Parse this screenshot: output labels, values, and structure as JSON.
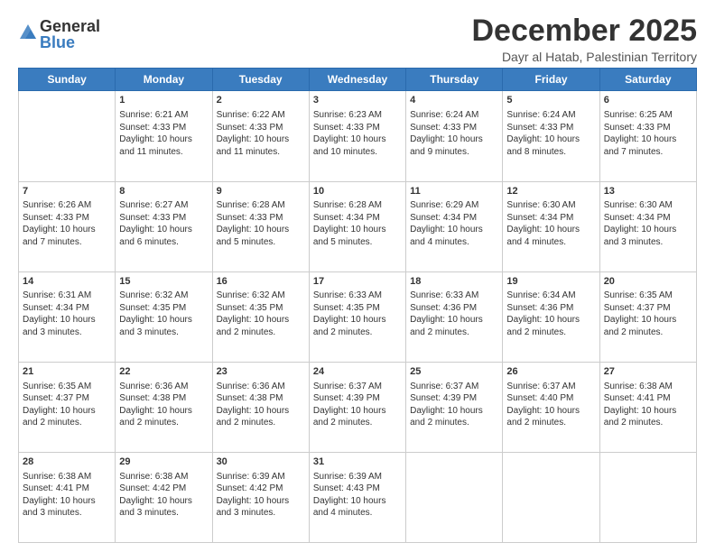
{
  "logo": {
    "general": "General",
    "blue": "Blue"
  },
  "title": "December 2025",
  "location": "Dayr al Hatab, Palestinian Territory",
  "days_of_week": [
    "Sunday",
    "Monday",
    "Tuesday",
    "Wednesday",
    "Thursday",
    "Friday",
    "Saturday"
  ],
  "weeks": [
    [
      {
        "day": "",
        "sunrise": "",
        "sunset": "",
        "daylight": ""
      },
      {
        "day": "1",
        "sunrise": "Sunrise: 6:21 AM",
        "sunset": "Sunset: 4:33 PM",
        "daylight": "Daylight: 10 hours and 11 minutes."
      },
      {
        "day": "2",
        "sunrise": "Sunrise: 6:22 AM",
        "sunset": "Sunset: 4:33 PM",
        "daylight": "Daylight: 10 hours and 11 minutes."
      },
      {
        "day": "3",
        "sunrise": "Sunrise: 6:23 AM",
        "sunset": "Sunset: 4:33 PM",
        "daylight": "Daylight: 10 hours and 10 minutes."
      },
      {
        "day": "4",
        "sunrise": "Sunrise: 6:24 AM",
        "sunset": "Sunset: 4:33 PM",
        "daylight": "Daylight: 10 hours and 9 minutes."
      },
      {
        "day": "5",
        "sunrise": "Sunrise: 6:24 AM",
        "sunset": "Sunset: 4:33 PM",
        "daylight": "Daylight: 10 hours and 8 minutes."
      },
      {
        "day": "6",
        "sunrise": "Sunrise: 6:25 AM",
        "sunset": "Sunset: 4:33 PM",
        "daylight": "Daylight: 10 hours and 7 minutes."
      }
    ],
    [
      {
        "day": "7",
        "sunrise": "Sunrise: 6:26 AM",
        "sunset": "Sunset: 4:33 PM",
        "daylight": "Daylight: 10 hours and 7 minutes."
      },
      {
        "day": "8",
        "sunrise": "Sunrise: 6:27 AM",
        "sunset": "Sunset: 4:33 PM",
        "daylight": "Daylight: 10 hours and 6 minutes."
      },
      {
        "day": "9",
        "sunrise": "Sunrise: 6:28 AM",
        "sunset": "Sunset: 4:33 PM",
        "daylight": "Daylight: 10 hours and 5 minutes."
      },
      {
        "day": "10",
        "sunrise": "Sunrise: 6:28 AM",
        "sunset": "Sunset: 4:34 PM",
        "daylight": "Daylight: 10 hours and 5 minutes."
      },
      {
        "day": "11",
        "sunrise": "Sunrise: 6:29 AM",
        "sunset": "Sunset: 4:34 PM",
        "daylight": "Daylight: 10 hours and 4 minutes."
      },
      {
        "day": "12",
        "sunrise": "Sunrise: 6:30 AM",
        "sunset": "Sunset: 4:34 PM",
        "daylight": "Daylight: 10 hours and 4 minutes."
      },
      {
        "day": "13",
        "sunrise": "Sunrise: 6:30 AM",
        "sunset": "Sunset: 4:34 PM",
        "daylight": "Daylight: 10 hours and 3 minutes."
      }
    ],
    [
      {
        "day": "14",
        "sunrise": "Sunrise: 6:31 AM",
        "sunset": "Sunset: 4:34 PM",
        "daylight": "Daylight: 10 hours and 3 minutes."
      },
      {
        "day": "15",
        "sunrise": "Sunrise: 6:32 AM",
        "sunset": "Sunset: 4:35 PM",
        "daylight": "Daylight: 10 hours and 3 minutes."
      },
      {
        "day": "16",
        "sunrise": "Sunrise: 6:32 AM",
        "sunset": "Sunset: 4:35 PM",
        "daylight": "Daylight: 10 hours and 2 minutes."
      },
      {
        "day": "17",
        "sunrise": "Sunrise: 6:33 AM",
        "sunset": "Sunset: 4:35 PM",
        "daylight": "Daylight: 10 hours and 2 minutes."
      },
      {
        "day": "18",
        "sunrise": "Sunrise: 6:33 AM",
        "sunset": "Sunset: 4:36 PM",
        "daylight": "Daylight: 10 hours and 2 minutes."
      },
      {
        "day": "19",
        "sunrise": "Sunrise: 6:34 AM",
        "sunset": "Sunset: 4:36 PM",
        "daylight": "Daylight: 10 hours and 2 minutes."
      },
      {
        "day": "20",
        "sunrise": "Sunrise: 6:35 AM",
        "sunset": "Sunset: 4:37 PM",
        "daylight": "Daylight: 10 hours and 2 minutes."
      }
    ],
    [
      {
        "day": "21",
        "sunrise": "Sunrise: 6:35 AM",
        "sunset": "Sunset: 4:37 PM",
        "daylight": "Daylight: 10 hours and 2 minutes."
      },
      {
        "day": "22",
        "sunrise": "Sunrise: 6:36 AM",
        "sunset": "Sunset: 4:38 PM",
        "daylight": "Daylight: 10 hours and 2 minutes."
      },
      {
        "day": "23",
        "sunrise": "Sunrise: 6:36 AM",
        "sunset": "Sunset: 4:38 PM",
        "daylight": "Daylight: 10 hours and 2 minutes."
      },
      {
        "day": "24",
        "sunrise": "Sunrise: 6:37 AM",
        "sunset": "Sunset: 4:39 PM",
        "daylight": "Daylight: 10 hours and 2 minutes."
      },
      {
        "day": "25",
        "sunrise": "Sunrise: 6:37 AM",
        "sunset": "Sunset: 4:39 PM",
        "daylight": "Daylight: 10 hours and 2 minutes."
      },
      {
        "day": "26",
        "sunrise": "Sunrise: 6:37 AM",
        "sunset": "Sunset: 4:40 PM",
        "daylight": "Daylight: 10 hours and 2 minutes."
      },
      {
        "day": "27",
        "sunrise": "Sunrise: 6:38 AM",
        "sunset": "Sunset: 4:41 PM",
        "daylight": "Daylight: 10 hours and 2 minutes."
      }
    ],
    [
      {
        "day": "28",
        "sunrise": "Sunrise: 6:38 AM",
        "sunset": "Sunset: 4:41 PM",
        "daylight": "Daylight: 10 hours and 3 minutes."
      },
      {
        "day": "29",
        "sunrise": "Sunrise: 6:38 AM",
        "sunset": "Sunset: 4:42 PM",
        "daylight": "Daylight: 10 hours and 3 minutes."
      },
      {
        "day": "30",
        "sunrise": "Sunrise: 6:39 AM",
        "sunset": "Sunset: 4:42 PM",
        "daylight": "Daylight: 10 hours and 3 minutes."
      },
      {
        "day": "31",
        "sunrise": "Sunrise: 6:39 AM",
        "sunset": "Sunset: 4:43 PM",
        "daylight": "Daylight: 10 hours and 4 minutes."
      },
      {
        "day": "",
        "sunrise": "",
        "sunset": "",
        "daylight": ""
      },
      {
        "day": "",
        "sunrise": "",
        "sunset": "",
        "daylight": ""
      },
      {
        "day": "",
        "sunrise": "",
        "sunset": "",
        "daylight": ""
      }
    ]
  ]
}
